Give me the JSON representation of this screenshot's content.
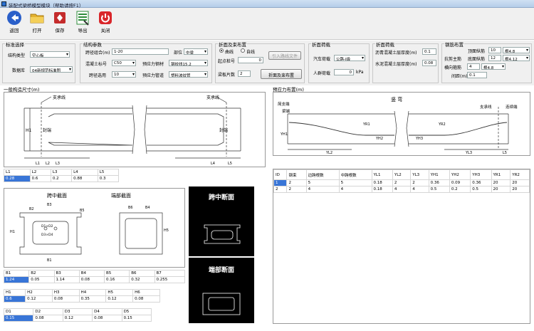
{
  "window": {
    "title": "装配式梁桥模型模块（帮助请按F1）"
  },
  "toolbar": {
    "items": [
      {
        "id": "back",
        "label": "返回",
        "icon": "back-arrow-icon",
        "color": "#2a5fc9"
      },
      {
        "id": "open",
        "label": "打开",
        "icon": "folder-icon",
        "color": "#e3b12f"
      },
      {
        "id": "save",
        "label": "保存",
        "icon": "save-icon",
        "color": "#c42b2b"
      },
      {
        "id": "export",
        "label": "导出",
        "icon": "excel-export-icon",
        "color": "#2e8b3a"
      },
      {
        "id": "close",
        "label": "关闭",
        "icon": "power-icon",
        "color": "#d9262a"
      }
    ]
  },
  "std": {
    "title": "标准选择",
    "struct_label": "结构类型",
    "struct_value": "空心板",
    "lib_label": "数据库",
    "lib_value": "04新规范标准图"
  },
  "struct": {
    "title": "结构参数",
    "span_label": "跨径组合(m)",
    "span_value": "1-20",
    "part_label": "部位",
    "part_value": "中梁",
    "conc_label": "混凝土标号",
    "conc_value": "C50",
    "steel_label": "预应力钢材",
    "steel_value": "钢绞线15.2",
    "span_sel_label": "跨径选用",
    "span_sel_value": "10",
    "duct_label": "预应力管道",
    "duct_value": "塑料波纹管"
  },
  "tendon": {
    "title": "折面及束布置",
    "opt1": "曲线",
    "opt2": "自线",
    "start_label": "起点桩号",
    "start_value": "0",
    "import_btn": "引入路线文件",
    "count_label": "梁板片数",
    "count_value": "2",
    "layout_btn": "折面及束布置"
  },
  "load": {
    "title": "折面荷载",
    "car_label": "汽车荷载",
    "car_value": "公路-I级",
    "crowd_label": "人群荷载",
    "crowd_value": "0",
    "crowd_unit": "kPa"
  },
  "surf": {
    "title": "折面荷载",
    "asph_label": "沥青混凝土层厚度(m)",
    "asph_value": "0.1",
    "conc_label": "水泥混凝土层厚度(m)",
    "conc_value": "0.08"
  },
  "rebar": {
    "title": "钢筋布置",
    "top_label": "顶面纵筋",
    "top_n": "10",
    "top_d": "根4.8",
    "bot_label": "底面纵筋",
    "bot_n": "12",
    "bot_d": "根4.12",
    "main_label": "抗剪主筋",
    "stir_label": "横向箍筋",
    "stir_n": "4",
    "stir_d": "根4.8",
    "space_label": "间距(m)",
    "space_value": "0.1"
  },
  "general": {
    "title": "一般构造尺寸(m)",
    "diagram": {
      "support_l": "支承线",
      "support_r": "支承线",
      "seal_l": "封端",
      "seal_r": "封端",
      "h1": "H1",
      "l1": "L1",
      "l2": "L2",
      "l3": "L3",
      "l4": "L4",
      "l5": "L5"
    },
    "table": {
      "headers": [
        "L1",
        "L2",
        "L3",
        "L4",
        "L5"
      ],
      "values": [
        "0.28",
        "0.6",
        "0.2",
        "0.88",
        "0.3"
      ]
    }
  },
  "sections": {
    "mid_title": "跨中截面",
    "end_title": "端部截面",
    "mid_dark": "跨中断面",
    "end_dark": "端部断面",
    "dims": {
      "b1": "B1",
      "b2": "B2",
      "b3": "B3",
      "b4": "B4",
      "b5": "B5",
      "b6": "B6",
      "h1": "H1",
      "h2": "H2",
      "h3": "H3",
      "h4": "H4",
      "h5": "H5",
      "d1": "D1×D2",
      "d2": "D3×D4"
    },
    "tableB": {
      "headers": [
        "B1",
        "B2",
        "B3",
        "B4",
        "B5",
        "B6",
        "B7"
      ],
      "values": [
        "1.24",
        "0.05",
        "1.14",
        "0.08",
        "0.16",
        "0.32",
        "0.255"
      ]
    },
    "tableH": {
      "headers": [
        "H1",
        "H2",
        "H3",
        "H4",
        "H5",
        "H6"
      ],
      "values": [
        "0.6",
        "0.12",
        "0.08",
        "0.35",
        "0.12",
        "0.08"
      ]
    },
    "tableD": {
      "headers": [
        "D1",
        "D2",
        "D3",
        "D4",
        "D5"
      ],
      "values": [
        "0.15",
        "0.08",
        "0.12",
        "0.08",
        "0.15"
      ]
    }
  },
  "prestress": {
    "title": "预应力布置(m)",
    "diagram": {
      "elev": "竖 弯",
      "span_end": "简支端",
      "beam_end": "梁端",
      "support_l": "支承线",
      "cont_end": "连续端",
      "yr1": "YR1",
      "yr2": "YR2",
      "yh1": "YH1",
      "yh2": "YH2",
      "yh3": "YH3",
      "yl2": "YL2",
      "yl3": "YL3",
      "l5": "L5"
    },
    "table": {
      "headers": [
        "ID",
        "钢束",
        "边跨根数",
        "中跨根数",
        "YL1",
        "YL2",
        "YL3",
        "YH1",
        "YH2",
        "YH3",
        "YR1",
        "YR2"
      ],
      "rows": [
        [
          "1",
          "2",
          "5",
          "5",
          "0.18",
          "2",
          "2",
          "0.36",
          "0.09",
          "0.36",
          "20",
          "20"
        ],
        [
          "2",
          "2",
          "4",
          "4",
          "0.18",
          "4",
          "4",
          "0.5",
          "0.2",
          "0.5",
          "20",
          "20"
        ]
      ]
    }
  }
}
